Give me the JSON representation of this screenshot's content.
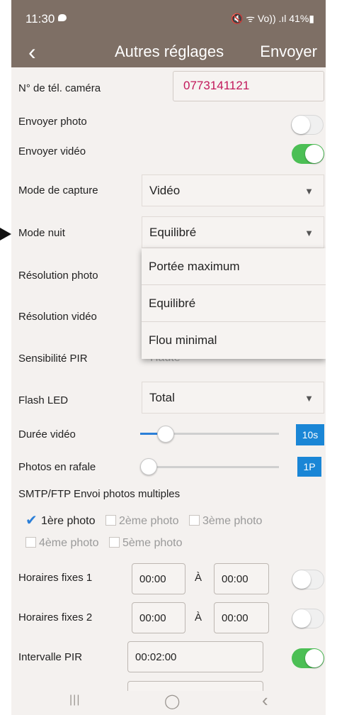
{
  "status": {
    "time": "11:30",
    "right": "🔇 ᯤ Vo)) .ıl 41%▮"
  },
  "header": {
    "back_glyph": "‹",
    "title": "Autres réglages",
    "send_label": "Envoyer"
  },
  "rows": {
    "phone_label": "N° de tél. caméra",
    "phone_value": "0773141121",
    "send_photo_label": "Envoyer photo",
    "send_video_label": "Envoyer vidéo",
    "capture_mode_label": "Mode de capture",
    "capture_mode_value": "Vidéo",
    "night_mode_label": "Mode nuit",
    "night_mode_value": "Equilibré",
    "photo_res_label": "Résolution photo",
    "video_res_label": "Résolution vidéo",
    "pir_label": "Sensibilité PIR",
    "pir_partial_value": "Haute",
    "flash_label": "Flash LED",
    "flash_value": "Total",
    "video_duration_label": "Durée vidéo",
    "video_duration_value": "10s",
    "burst_label": "Photos en rafale",
    "burst_value": "1P",
    "smtp_label": "SMTP/FTP Envoi photos multiples",
    "fixed1_label": "Horaires fixes 1",
    "fixed2_label": "Horaires fixes 2",
    "interval_label": "Intervalle PIR",
    "interval_value": "00:02:00"
  },
  "toggles": {
    "send_photo": false,
    "send_video": true,
    "fixed1": false,
    "fixed2": false,
    "interval": true
  },
  "sliders": {
    "video_duration_level": 0.12,
    "burst_level": 0.0
  },
  "checkboxes": [
    {
      "label": "1ère photo",
      "checked": true
    },
    {
      "label": "2ème photo",
      "checked": false
    },
    {
      "label": "3ème photo",
      "checked": false
    },
    {
      "label": "4ème photo",
      "checked": false
    },
    {
      "label": "5ème photo",
      "checked": false
    }
  ],
  "schedule": {
    "fixed1_from": "00:00",
    "fixed1_to": "00:00",
    "fixed2_from": "00:00",
    "fixed2_to": "00:00",
    "a_label": "À"
  },
  "dropdown": {
    "options": [
      "Portée maximum",
      "Equilibré",
      "Flou minimal"
    ]
  },
  "navbar": {
    "recent": "|||",
    "home": "◯",
    "back": "‹"
  },
  "colors": {
    "header": "#7e6f65",
    "toggle_on": "#4cbf55",
    "accent_blue": "#1a86d6",
    "phone_text": "#c2185b"
  }
}
